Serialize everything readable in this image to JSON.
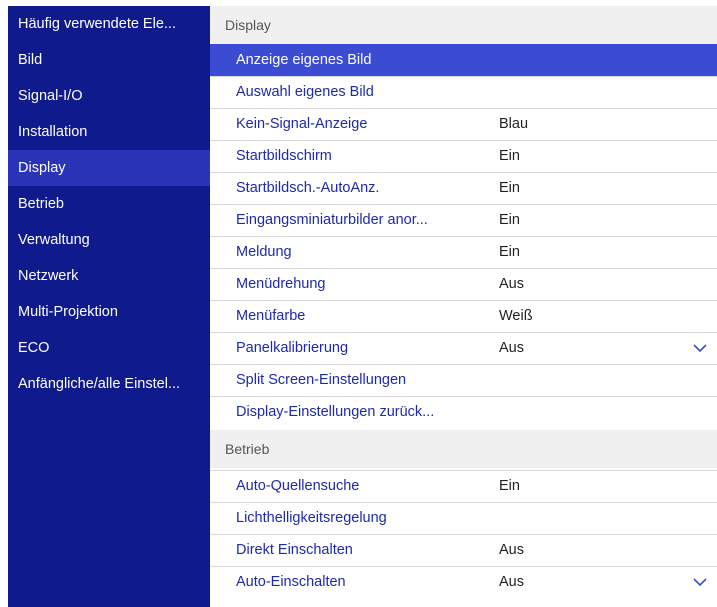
{
  "sidebar": {
    "items": [
      {
        "label": "Häufig verwendete Ele..."
      },
      {
        "label": "Bild"
      },
      {
        "label": "Signal-I/O"
      },
      {
        "label": "Installation"
      },
      {
        "label": "Display"
      },
      {
        "label": "Betrieb"
      },
      {
        "label": "Verwaltung"
      },
      {
        "label": "Netzwerk"
      },
      {
        "label": "Multi-Projektion"
      },
      {
        "label": "ECO"
      },
      {
        "label": "Anfängliche/alle Einstel..."
      }
    ],
    "active": "Display"
  },
  "main": {
    "sections": [
      {
        "title": "Display",
        "rows": [
          {
            "label": "Anzeige eigenes Bild",
            "value": "",
            "selected": true
          },
          {
            "label": "Auswahl eigenes Bild",
            "value": ""
          },
          {
            "label": "Kein-Signal-Anzeige",
            "value": "Blau"
          },
          {
            "label": "Startbildschirm",
            "value": "Ein"
          },
          {
            "label": "Startbildsch.-AutoAnz.",
            "value": "Ein"
          },
          {
            "label": "Eingangsminiaturbilder anor...",
            "value": "Ein"
          },
          {
            "label": "Meldung",
            "value": "Ein"
          },
          {
            "label": "Menüdrehung",
            "value": "Aus"
          },
          {
            "label": "Menüfarbe",
            "value": "Weiß"
          },
          {
            "label": "Panelkalibrierung",
            "value": "Aus",
            "chevron": true
          },
          {
            "label": "Split Screen-Einstellungen",
            "value": ""
          },
          {
            "label": "Display-Einstellungen zurück...",
            "value": ""
          }
        ]
      },
      {
        "title": "Betrieb",
        "rows": [
          {
            "label": "Auto-Quellensuche",
            "value": "Ein"
          },
          {
            "label": "Lichthelligkeitsregelung",
            "value": ""
          },
          {
            "label": "Direkt Einschalten",
            "value": "Aus"
          },
          {
            "label": "Auto-Einschalten",
            "value": "Aus",
            "chevron": true
          }
        ]
      }
    ]
  },
  "colors": {
    "sidebar_bg": "#0f1a8c",
    "sidebar_active": "#2a34b8",
    "selected_row": "#3b4bd2",
    "label_text": "#1e2aa8"
  },
  "icons": {
    "scroll_indicator": "chevron-down-icon"
  }
}
